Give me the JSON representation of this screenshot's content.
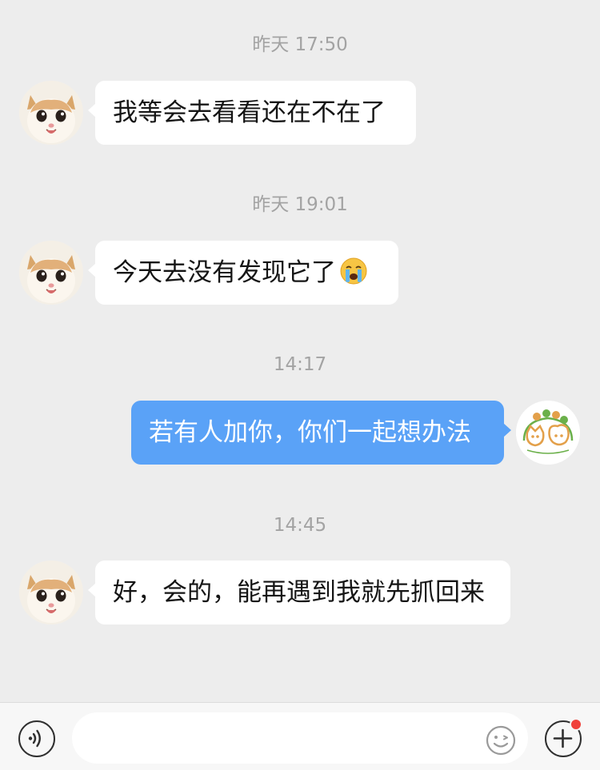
{
  "messages": [
    {
      "timestamp": "昨天 17:50",
      "direction": "incoming",
      "text": "我等会去看看还在不在了"
    },
    {
      "timestamp": "昨天 19:01",
      "direction": "incoming",
      "text": "今天去没有发现它了",
      "emoji": "loudly-crying-face"
    },
    {
      "timestamp": "14:17",
      "direction": "outgoing",
      "text": "若有人加你，你们一起想办法"
    },
    {
      "timestamp": "14:45",
      "direction": "incoming",
      "text": "好，会的，能再遇到我就先抓回来"
    }
  ],
  "input": {
    "placeholder": "",
    "value": ""
  },
  "icons": {
    "voice": "voice-icon",
    "emoji": "smiley-icon",
    "more": "plus-icon"
  },
  "colors": {
    "background": "#ededed",
    "incoming_bubble": "#ffffff",
    "outgoing_bubble": "#5aa2f7",
    "timestamp_text": "#a3a3a3",
    "notification_dot": "#f0413b"
  }
}
